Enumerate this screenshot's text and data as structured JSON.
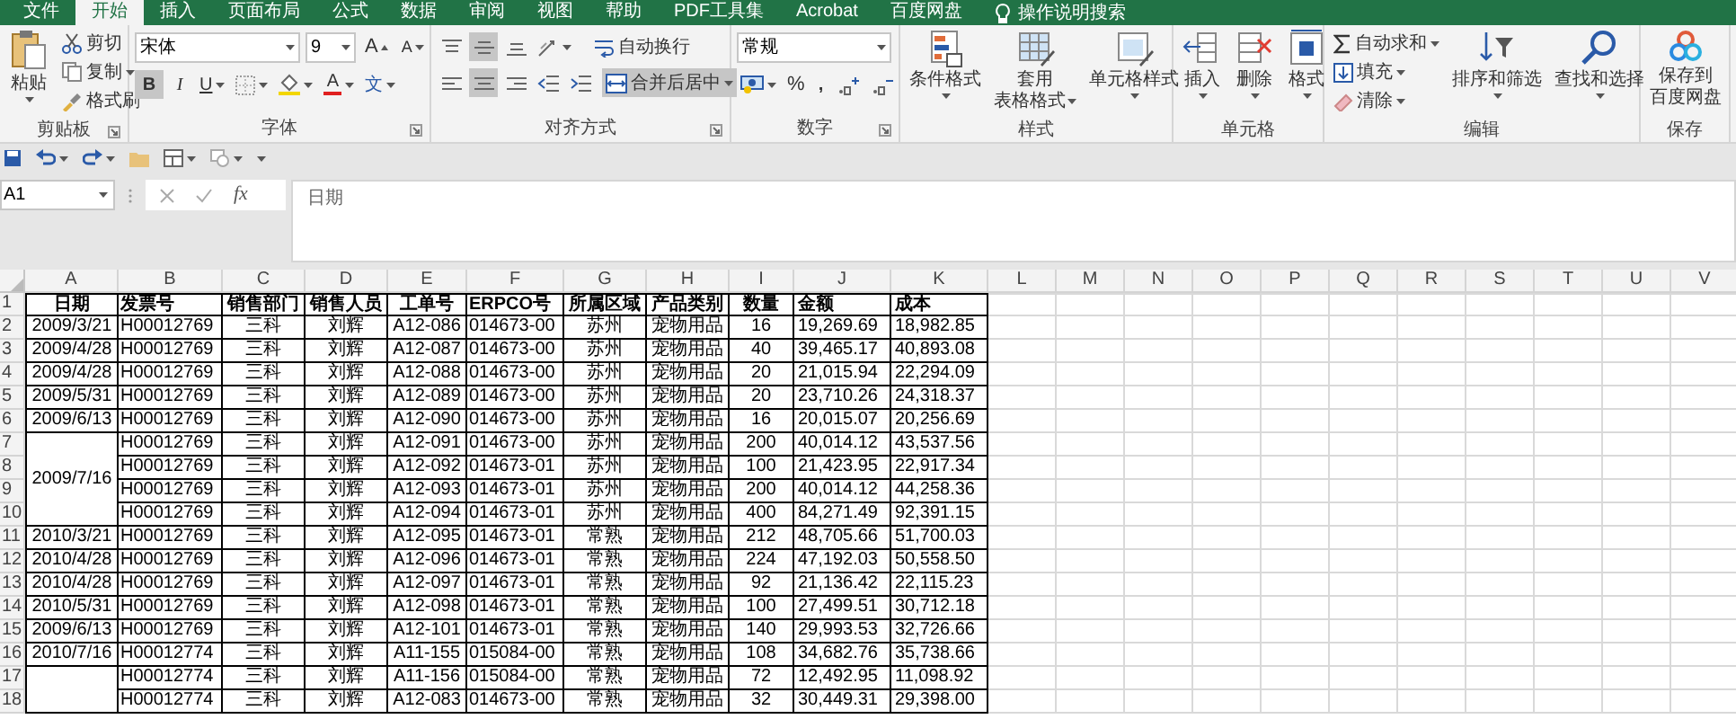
{
  "tabs": [
    {
      "label": "文件",
      "selected": false
    },
    {
      "label": "开始",
      "selected": true
    },
    {
      "label": "插入",
      "selected": false
    },
    {
      "label": "页面布局",
      "selected": false
    },
    {
      "label": "公式",
      "selected": false
    },
    {
      "label": "数据",
      "selected": false
    },
    {
      "label": "审阅",
      "selected": false
    },
    {
      "label": "视图",
      "selected": false
    },
    {
      "label": "帮助",
      "selected": false
    },
    {
      "label": "PDF工具集",
      "selected": false
    },
    {
      "label": "Acrobat",
      "selected": false
    },
    {
      "label": "百度网盘",
      "selected": false
    }
  ],
  "tell_me": "操作说明搜索",
  "ribbon": {
    "clipboard": {
      "label": "剪贴板",
      "paste": "粘贴",
      "cut": "剪切",
      "copy": "复制",
      "format_painter": "格式刷"
    },
    "font": {
      "label": "字体",
      "font_name": "宋体",
      "font_size": "9",
      "grow_font": "A",
      "shrink_font": "A",
      "bold": {
        "text": "B",
        "pressed": true
      },
      "italic": {
        "text": "I",
        "pressed": false
      },
      "underline": {
        "text": "U",
        "pressed": false
      },
      "font_color": "A",
      "phonetic": "文"
    },
    "alignment": {
      "label": "对齐方式",
      "vertical": [
        {
          "selected": false
        },
        {
          "selected": true
        },
        {
          "selected": false
        }
      ],
      "horizontal": [
        {
          "selected": false
        },
        {
          "selected": true
        },
        {
          "selected": false
        }
      ],
      "wrap_text": "自动换行",
      "merge_center": {
        "text": "合并后居中",
        "pressed": true
      }
    },
    "number": {
      "label": "数字",
      "format": "常规",
      "percent": "%",
      "comma": ","
    },
    "styles": {
      "label": "样式",
      "buttons": [
        {
          "lines": [
            "条件格式"
          ]
        },
        {
          "lines": [
            "套用",
            "表格格式"
          ]
        },
        {
          "lines": [
            "单元格样式"
          ]
        }
      ]
    },
    "cells": {
      "label": "单元格",
      "buttons": [
        "插入",
        "删除",
        "格式"
      ]
    },
    "editing": {
      "label": "编辑",
      "autosum": "自动求和",
      "fill": "填充",
      "clear": "清除",
      "sort_filter": "排序和筛选",
      "find_select": "查找和选择"
    },
    "save": {
      "label": "保存",
      "button": [
        "保存到",
        "百度网盘"
      ]
    }
  },
  "formula_bar": {
    "name_box": "A1",
    "fx": "fx",
    "formula": "日期"
  },
  "sheet": {
    "columns": [
      "A",
      "B",
      "C",
      "D",
      "E",
      "F",
      "G",
      "H",
      "I",
      "J",
      "K",
      "L",
      "M",
      "N",
      "O",
      "P",
      "Q",
      "R",
      "S",
      "T",
      "U",
      "V"
    ],
    "rows": [
      {
        "number": "1",
        "cells": [
          "日期",
          "发票号",
          "销售部门",
          "销售人员",
          "工单号",
          "ERPCO号",
          "所属区域",
          "产品类别",
          "数量",
          "金额",
          "成本"
        ]
      },
      {
        "number": "2",
        "cells": [
          "2009/3/21",
          "H00012769",
          "三科",
          "刘辉",
          "A12-086",
          "014673-00",
          "苏州",
          "宠物用品",
          "16",
          "19,269.69",
          "18,982.85"
        ]
      },
      {
        "number": "3",
        "cells": [
          "2009/4/28",
          "H00012769",
          "三科",
          "刘辉",
          "A12-087",
          "014673-00",
          "苏州",
          "宠物用品",
          "40",
          "39,465.17",
          "40,893.08"
        ]
      },
      {
        "number": "4",
        "cells": [
          "2009/4/28",
          "H00012769",
          "三科",
          "刘辉",
          "A12-088",
          "014673-00",
          "苏州",
          "宠物用品",
          "20",
          "21,015.94",
          "22,294.09"
        ]
      },
      {
        "number": "5",
        "cells": [
          "2009/5/31",
          "H00012769",
          "三科",
          "刘辉",
          "A12-089",
          "014673-00",
          "苏州",
          "宠物用品",
          "20",
          "23,710.26",
          "24,318.37"
        ]
      },
      {
        "number": "6",
        "cells": [
          "2009/6/13",
          "H00012769",
          "三科",
          "刘辉",
          "A12-090",
          "014673-00",
          "苏州",
          "宠物用品",
          "16",
          "20,015.07",
          "20,256.69"
        ]
      },
      {
        "number": "7",
        "cells": [
          {
            "text": "2009/7/16",
            "rowspan": 4
          },
          "H00012769",
          "三科",
          "刘辉",
          "A12-091",
          "014673-00",
          "苏州",
          "宠物用品",
          "200",
          "40,014.12",
          "43,537.56"
        ]
      },
      {
        "number": "8",
        "cells": [
          "H00012769",
          "三科",
          "刘辉",
          "A12-092",
          "014673-01",
          "苏州",
          "宠物用品",
          "100",
          "21,423.95",
          "22,917.34"
        ]
      },
      {
        "number": "9",
        "cells": [
          "H00012769",
          "三科",
          "刘辉",
          "A12-093",
          "014673-01",
          "苏州",
          "宠物用品",
          "200",
          "40,014.12",
          "44,258.36"
        ]
      },
      {
        "number": "10",
        "cells": [
          "H00012769",
          "三科",
          "刘辉",
          "A12-094",
          "014673-01",
          "苏州",
          "宠物用品",
          "400",
          "84,271.49",
          "92,391.15"
        ]
      },
      {
        "number": "11",
        "cells": [
          "2010/3/21",
          "H00012769",
          "三科",
          "刘辉",
          "A12-095",
          "014673-01",
          "常熟",
          "宠物用品",
          "212",
          "48,705.66",
          "51,700.03"
        ]
      },
      {
        "number": "12",
        "cells": [
          "2010/4/28",
          "H00012769",
          "三科",
          "刘辉",
          "A12-096",
          "014673-01",
          "常熟",
          "宠物用品",
          "224",
          "47,192.03",
          "50,558.50"
        ]
      },
      {
        "number": "13",
        "cells": [
          "2010/4/28",
          "H00012769",
          "三科",
          "刘辉",
          "A12-097",
          "014673-01",
          "常熟",
          "宠物用品",
          "92",
          "21,136.42",
          "22,115.23"
        ]
      },
      {
        "number": "14",
        "cells": [
          "2010/5/31",
          "H00012769",
          "三科",
          "刘辉",
          "A12-098",
          "014673-01",
          "常熟",
          "宠物用品",
          "100",
          "27,499.51",
          "30,712.18"
        ]
      },
      {
        "number": "15",
        "cells": [
          "2009/6/13",
          "H00012769",
          "三科",
          "刘辉",
          "A12-101",
          "014673-01",
          "常熟",
          "宠物用品",
          "140",
          "29,993.53",
          "32,726.66"
        ]
      },
      {
        "number": "16",
        "cells": [
          "2010/7/16",
          "H00012774",
          "三科",
          "刘辉",
          "A11-155",
          "015084-00",
          "常熟",
          "宠物用品",
          "108",
          "34,682.76",
          "35,738.66"
        ]
      },
      {
        "number": "17",
        "cells": [
          {
            "rowspan": 2
          },
          "H00012774",
          "三科",
          "刘辉",
          "A11-156",
          "015084-00",
          "常熟",
          "宠物用品",
          "72",
          "12,492.95",
          "11,098.92"
        ]
      },
      {
        "number": "18",
        "cells": [
          "H00012774",
          "三科",
          "刘辉",
          "A12-083",
          "014673-00",
          "常熟",
          "宠物用品",
          "32",
          "30,449.31",
          "29,398.00"
        ]
      }
    ]
  }
}
